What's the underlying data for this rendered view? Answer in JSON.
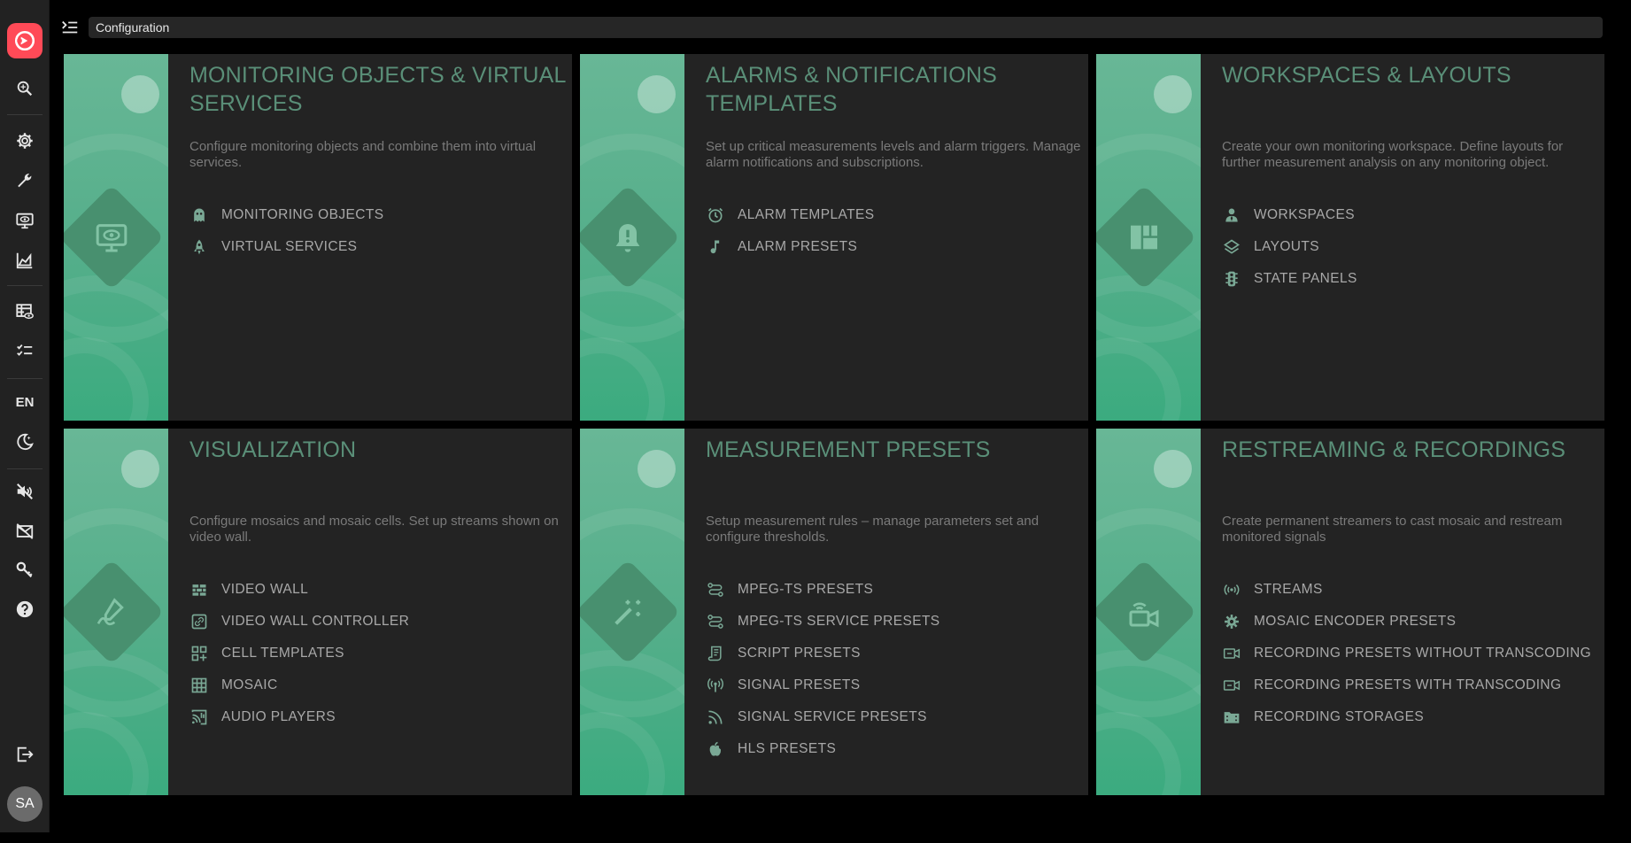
{
  "sidebar": {
    "language": "EN",
    "avatar_initials": "SA",
    "items": [
      {
        "name": "search-icon"
      },
      {
        "name": "gear-icon"
      },
      {
        "name": "wrench-icon"
      },
      {
        "name": "monitor-eye-icon"
      },
      {
        "name": "chart-area-icon"
      },
      {
        "name": "table-eye-icon"
      },
      {
        "name": "checklist-icon"
      },
      {
        "name": "moon-icon"
      },
      {
        "name": "mute-icon"
      },
      {
        "name": "no-mail-icon"
      },
      {
        "name": "key-icon"
      },
      {
        "name": "help-icon"
      },
      {
        "name": "logout-icon"
      }
    ]
  },
  "header": {
    "breadcrumb": "Configuration"
  },
  "colors": {
    "accent_green": "#3bab7f",
    "title_green": "#5a8f78",
    "logo_red": "#ff4a57",
    "card_bg": "#232323"
  },
  "cards": [
    {
      "icon": "monitor-eye-icon",
      "title": "MONITORING OBJECTS & VIRTUAL SERVICES",
      "description": "Configure monitoring objects and combine them into virtual services.",
      "links": [
        {
          "label": "MONITORING OBJECTS",
          "icon": "ghost-icon"
        },
        {
          "label": "VIRTUAL SERVICES",
          "icon": "rocket-icon"
        }
      ]
    },
    {
      "icon": "bell-alert-icon",
      "title": "ALARMS & NOTIFICATIONS TEMPLATES",
      "description": "Set up critical measurements levels and alarm triggers. Manage alarm notifications and subscriptions.",
      "links": [
        {
          "label": "ALARM TEMPLATES",
          "icon": "alarm-clock-icon"
        },
        {
          "label": "ALARM PRESETS",
          "icon": "music-note-icon"
        }
      ]
    },
    {
      "icon": "dashboard-icon",
      "title": "WORKSPACES & LAYOUTS",
      "description": "Create your own monitoring workspace. Define layouts for further measurement analysis on any monitoring object.",
      "links": [
        {
          "label": "WORKSPACES",
          "icon": "user-tie-icon"
        },
        {
          "label": "LAYOUTS",
          "icon": "layers-icon"
        },
        {
          "label": "STATE PANELS",
          "icon": "traffic-light-icon"
        }
      ]
    },
    {
      "icon": "draw-icon",
      "title": "VISUALIZATION",
      "description": "Configure mosaics and mosaic cells. Set up streams shown on video wall.",
      "links": [
        {
          "label": "VIDEO WALL",
          "icon": "wall-icon"
        },
        {
          "label": "VIDEO WALL CONTROLLER",
          "icon": "controller-link-icon"
        },
        {
          "label": "CELL TEMPLATES",
          "icon": "grid-plus-icon"
        },
        {
          "label": "MOSAIC",
          "icon": "grid-icon"
        },
        {
          "label": "AUDIO PLAYERS",
          "icon": "cast-audio-icon"
        }
      ]
    },
    {
      "icon": "magic-wand-icon",
      "title": "MEASUREMENT PRESETS",
      "description": "Setup measurement rules – manage parameters set and configure thresholds.",
      "links": [
        {
          "label": "MPEG-TS PRESETS",
          "icon": "transit-icon"
        },
        {
          "label": "MPEG-TS SERVICE PRESETS",
          "icon": "transit-icon"
        },
        {
          "label": "SCRIPT PRESETS",
          "icon": "script-icon"
        },
        {
          "label": "SIGNAL PRESETS",
          "icon": "antenna-icon"
        },
        {
          "label": "SIGNAL SERVICE PRESETS",
          "icon": "rss-icon"
        },
        {
          "label": "HLS PRESETS",
          "icon": "apple-icon"
        }
      ]
    },
    {
      "icon": "video-wireless-icon",
      "title": "RESTREAMING & RECORDINGS",
      "description": "Create permanent streamers to cast mosaic and restream monitored signals",
      "links": [
        {
          "label": "STREAMS",
          "icon": "broadcast-icon"
        },
        {
          "label": "MOSAIC ENCODER PRESETS",
          "icon": "cog-icon"
        },
        {
          "label": "RECORDING PRESETS WITHOUT TRANSCODING",
          "icon": "video-box-icon"
        },
        {
          "label": "RECORDING PRESETS WITH TRANSCODING",
          "icon": "video-box-icon"
        },
        {
          "label": "RECORDING STORAGES",
          "icon": "film-folder-icon"
        }
      ]
    }
  ]
}
